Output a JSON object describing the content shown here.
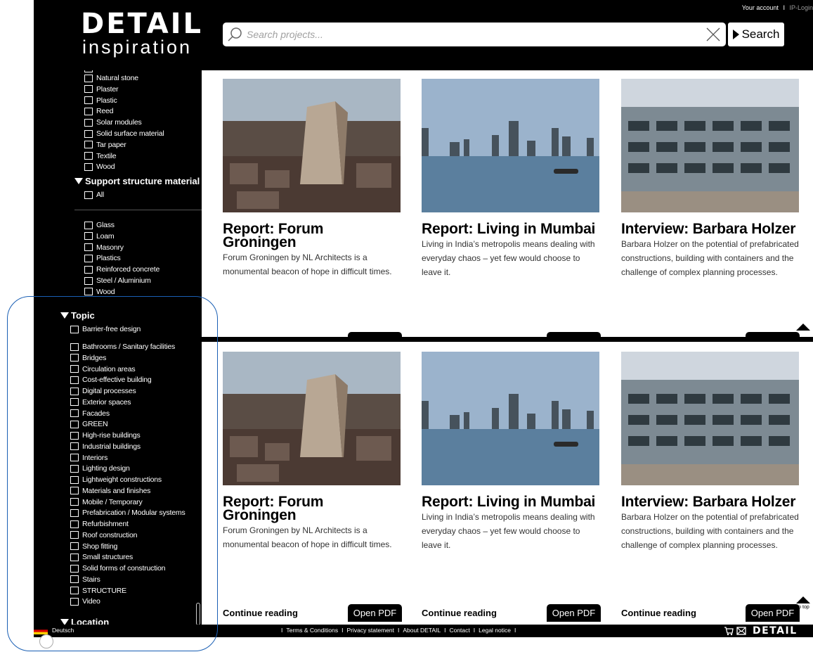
{
  "header": {
    "logo_main": "DETAIL",
    "logo_sub": "inspiration",
    "account_link": "Your account",
    "account_sep": "I",
    "ip_login": "IP-Login",
    "search_placeholder": "Search projects...",
    "search_button": "Search"
  },
  "sidebar": {
    "materials_top": [
      "Natural stone",
      "Plaster",
      "Plastic",
      "Reed",
      "Solar modules",
      "Solid surface material",
      "Tar paper",
      "Textile",
      "Wood"
    ],
    "support_heading": "Support structure material",
    "support_all": "All",
    "support_items": [
      "Glass",
      "Loam",
      "Masonry",
      "Plastics",
      "Reinforced concrete",
      "Steel / Aluminium",
      "Wood"
    ],
    "topic_heading": "Topic",
    "topic_first": "Barrier-free design",
    "topic_items": [
      "Bathrooms / Sanitary facilities",
      "Bridges",
      "Circulation areas",
      "Cost-effective building",
      "Digital processes",
      "Exterior spaces",
      "Facades",
      "GREEN",
      "High-rise buildings",
      "Industrial buildings",
      "Interiors",
      "Lighting design",
      "Lightweight constructions",
      "Materials and finishes",
      "Mobile / Temporary",
      "Prefabrication / Modular systems",
      "Refurbishment",
      "Roof construction",
      "Shop fitting",
      "Small structures",
      "Solid forms of construction",
      "Stairs",
      "STRUCTURE",
      "Video"
    ],
    "location_heading": "Location"
  },
  "cards_row1": [
    {
      "title": "Report: Forum Groningen",
      "desc": "Forum Groningen by NL Architects is a monumental beacon of hope in difficult times."
    },
    {
      "title": "Report: Living in Mumbai",
      "desc": "Living in India’s metropolis means dealing with everyday chaos – yet few would choose to leave it."
    },
    {
      "title": "Interview: Barbara Holzer",
      "desc": "Barbara Holzer on the potential of prefabricated constructions, building with containers and the challenge of complex planning processes."
    }
  ],
  "cards_row2": [
    {
      "title": "Report: Forum Groningen",
      "desc": "Forum Groningen by NL Architects is a monumental beacon of hope in difficult times."
    },
    {
      "title": "Report: Living in Mumbai",
      "desc": "Living in India’s metropolis means dealing with everyday chaos – yet few would choose to leave it."
    },
    {
      "title": "Interview: Barbara Holzer",
      "desc": "Barbara Holzer on the potential of prefabricated constructions, building with containers and the challenge of complex planning processes."
    }
  ],
  "actions": {
    "continue_reading": "Continue reading",
    "open_pdf": "Open PDF",
    "to_top": "to top"
  },
  "footer": {
    "language": "Deutsch",
    "links": [
      "Terms & Conditions",
      "Privacy statement",
      "About DETAIL",
      "Contact",
      "Legal notice"
    ],
    "sep": "I",
    "logo": "DETAIL"
  },
  "colors": {
    "background": "#000000",
    "content": "#ffffff",
    "annotation": "#1a5fb4"
  }
}
